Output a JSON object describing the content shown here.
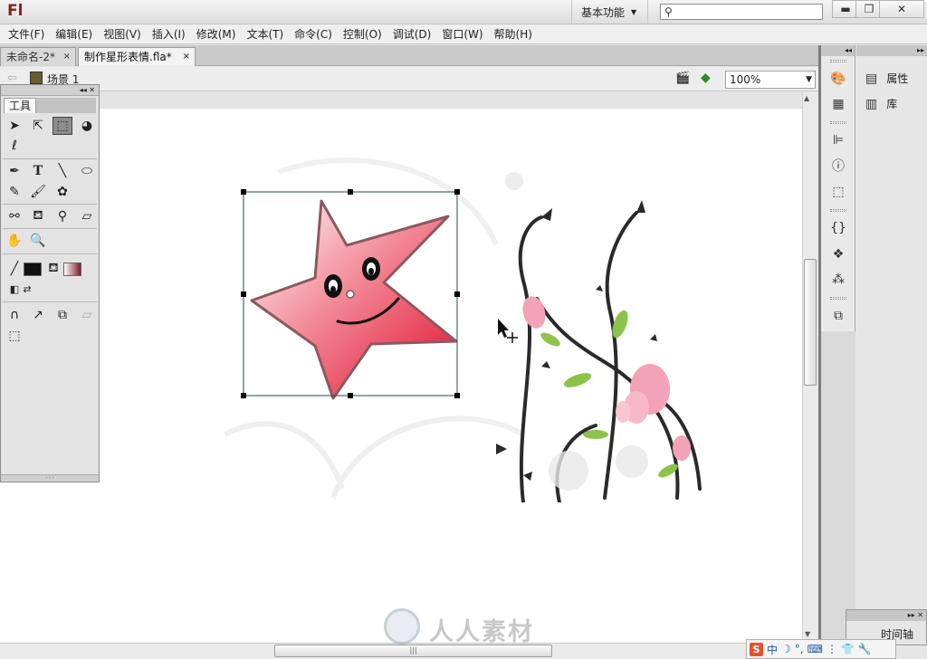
{
  "app": {
    "logo": "Fl",
    "workspace": "基本功能",
    "search_placeholder": ""
  },
  "window_buttons": {
    "minimize": "▬",
    "maximize": "❐",
    "close": "✕"
  },
  "menu": [
    "文件(F)",
    "编辑(E)",
    "视图(V)",
    "插入(I)",
    "修改(M)",
    "文本(T)",
    "命令(C)",
    "控制(O)",
    "调试(D)",
    "窗口(W)",
    "帮助(H)"
  ],
  "tabs": [
    {
      "label": "未命名-2*",
      "close": "×"
    },
    {
      "label": "制作星形表情.fla*",
      "close": "×"
    }
  ],
  "editbar": {
    "scene": "场景 1",
    "zoom": "100%"
  },
  "tools": {
    "title": "工具"
  },
  "right_panels": {
    "properties": "属性",
    "library": "库",
    "timeline": "时间轴"
  },
  "ime": {
    "lang": "中"
  },
  "watermark": {
    "text": "人人素材"
  },
  "colors": {
    "stroke": "#111111",
    "star": "#e8364f",
    "accent": "#8a1f1f"
  }
}
